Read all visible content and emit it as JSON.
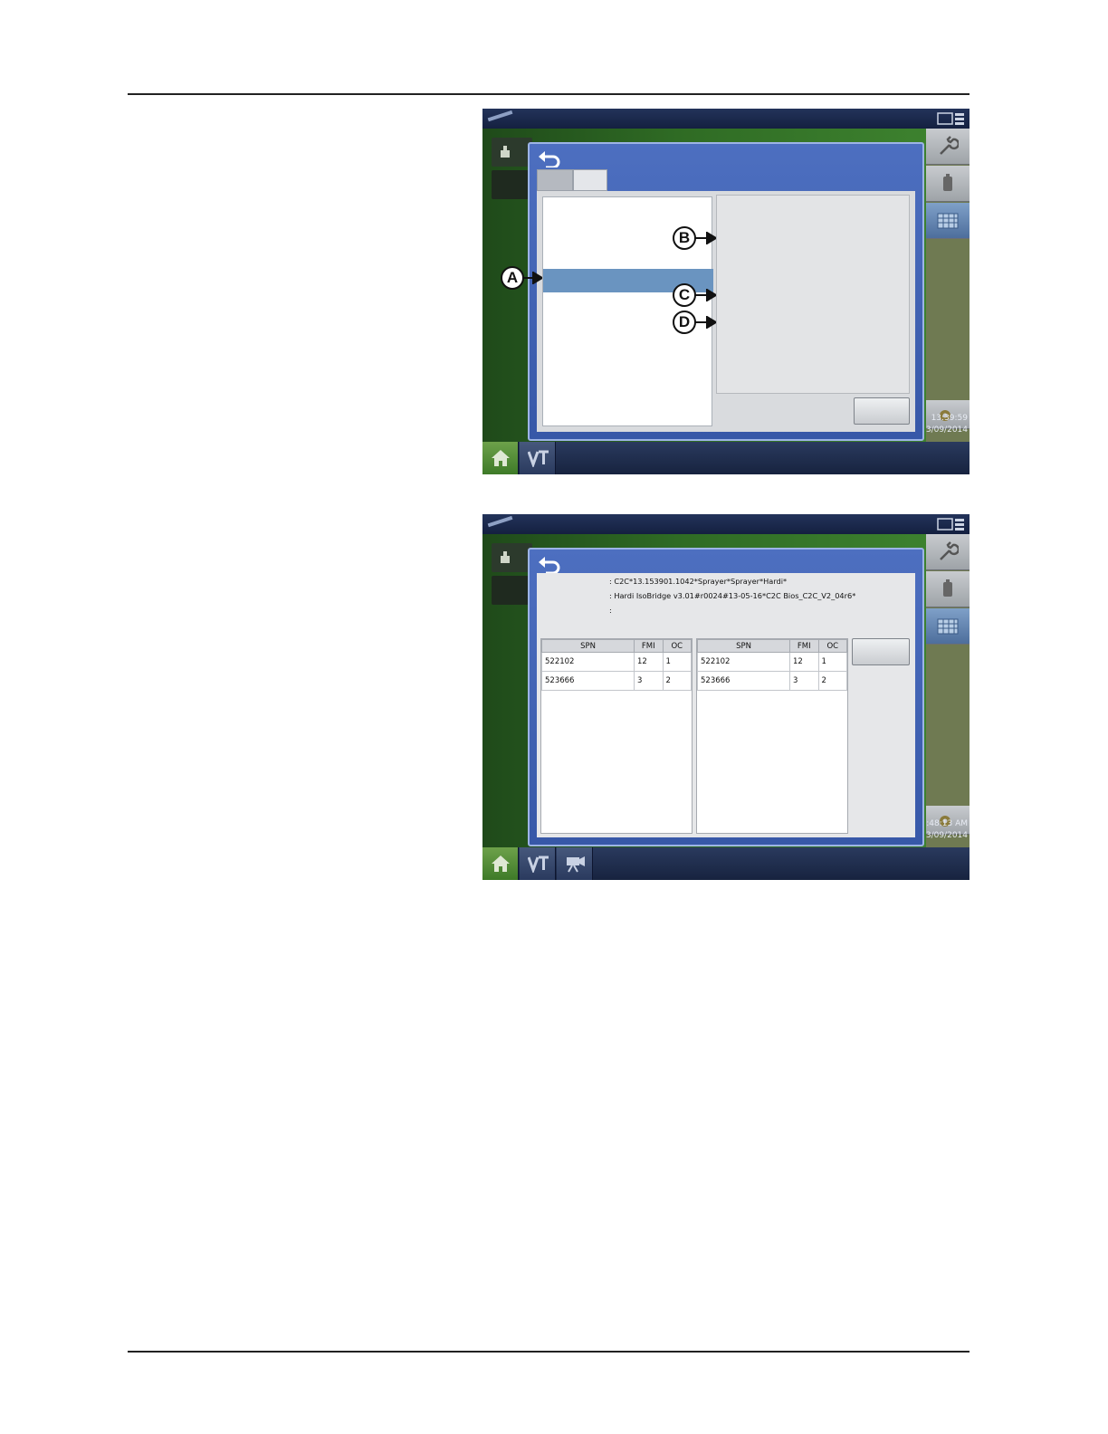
{
  "screen1": {
    "callouts": [
      "A",
      "B",
      "C",
      "D"
    ],
    "clock": {
      "time": "13:39:59",
      "date": "3/09/2014"
    }
  },
  "screen2": {
    "info_lines": [
      ": C2C*13.153901.1042*Sprayer*Sprayer*Hardi*",
      ": Hardi IsoBridge v3.01#r0024#13-05-16*C2C Bios_C2C_V2_04r6*",
      ":"
    ],
    "table_headers": [
      "SPN",
      "FMI",
      "OC"
    ],
    "left_table": [
      {
        "spn": "522102",
        "fmi": "12",
        "oc": "1"
      },
      {
        "spn": "523666",
        "fmi": "3",
        "oc": "2"
      }
    ],
    "right_table": [
      {
        "spn": "522102",
        "fmi": "12",
        "oc": "1"
      },
      {
        "spn": "523666",
        "fmi": "3",
        "oc": "2"
      }
    ],
    "clock": {
      "time": ":48:13 AM",
      "date": "3/09/2014"
    }
  }
}
